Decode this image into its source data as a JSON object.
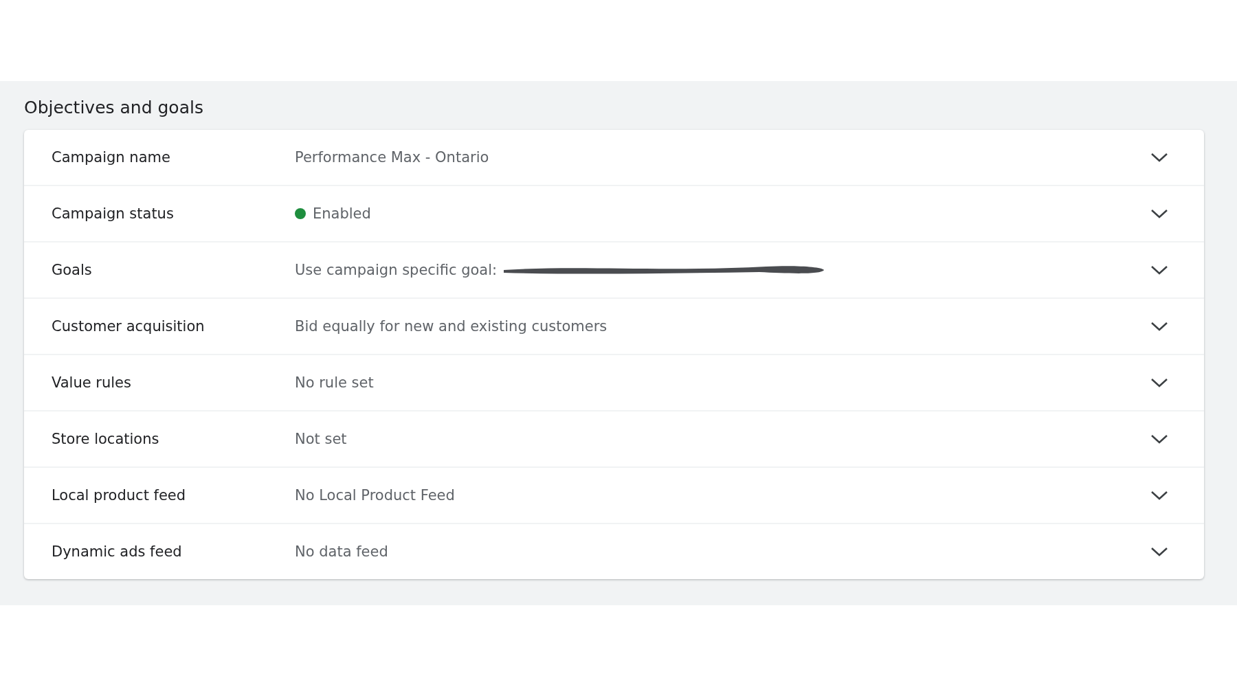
{
  "section": {
    "title": "Objectives and goals"
  },
  "rows": [
    {
      "label": "Campaign name",
      "value": "Performance Max - Ontario",
      "expanded": false
    },
    {
      "label": "Campaign status",
      "value": "Enabled",
      "color": "#1e8e3e",
      "expanded": false
    },
    {
      "label": "Goals",
      "value": "Use campaign specific goal:",
      "redacted": true,
      "expanded": false
    },
    {
      "label": "Customer acquisition",
      "value": "Bid equally for new and existing customers",
      "expanded": false
    },
    {
      "label": "Value rules",
      "value": "No rule set",
      "expanded": false
    },
    {
      "label": "Store locations",
      "value": "Not set",
      "expanded": false
    },
    {
      "label": "Local product feed",
      "value": "No Local Product Feed",
      "expanded": false
    },
    {
      "label": "Dynamic ads feed",
      "value": "No data feed",
      "expanded": false
    }
  ]
}
